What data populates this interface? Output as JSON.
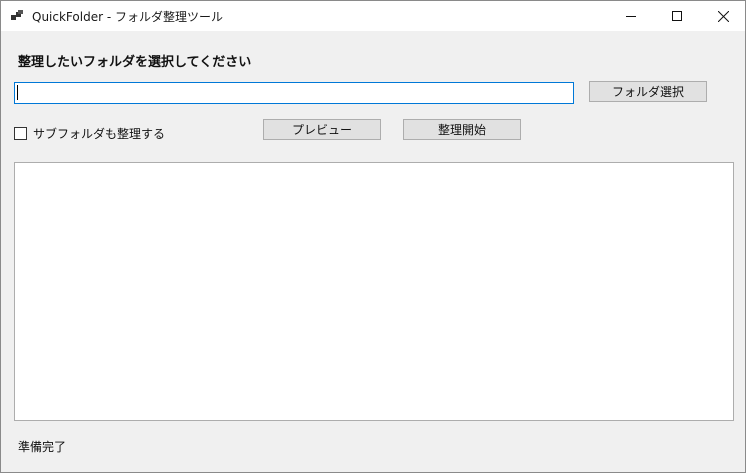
{
  "window": {
    "title": "QuickFolder - フォルダ整理ツール",
    "icon": "app-icon",
    "controls": [
      "minimize-icon",
      "maximize-icon",
      "close-icon"
    ]
  },
  "form": {
    "heading": "整理したいフォルダを選択してください",
    "path_value": "",
    "select_folder_label": "フォルダ選択",
    "include_subfolders_label": "サブフォルダも整理する",
    "include_subfolders_checked": false,
    "preview_label": "プレビュー",
    "start_label": "整理開始",
    "log_text": ""
  },
  "status": {
    "text": "準備完了"
  },
  "colors": {
    "focus_border": "#0078d7",
    "button_bg": "#e1e1e1",
    "window_bg": "#f0f0f0"
  }
}
